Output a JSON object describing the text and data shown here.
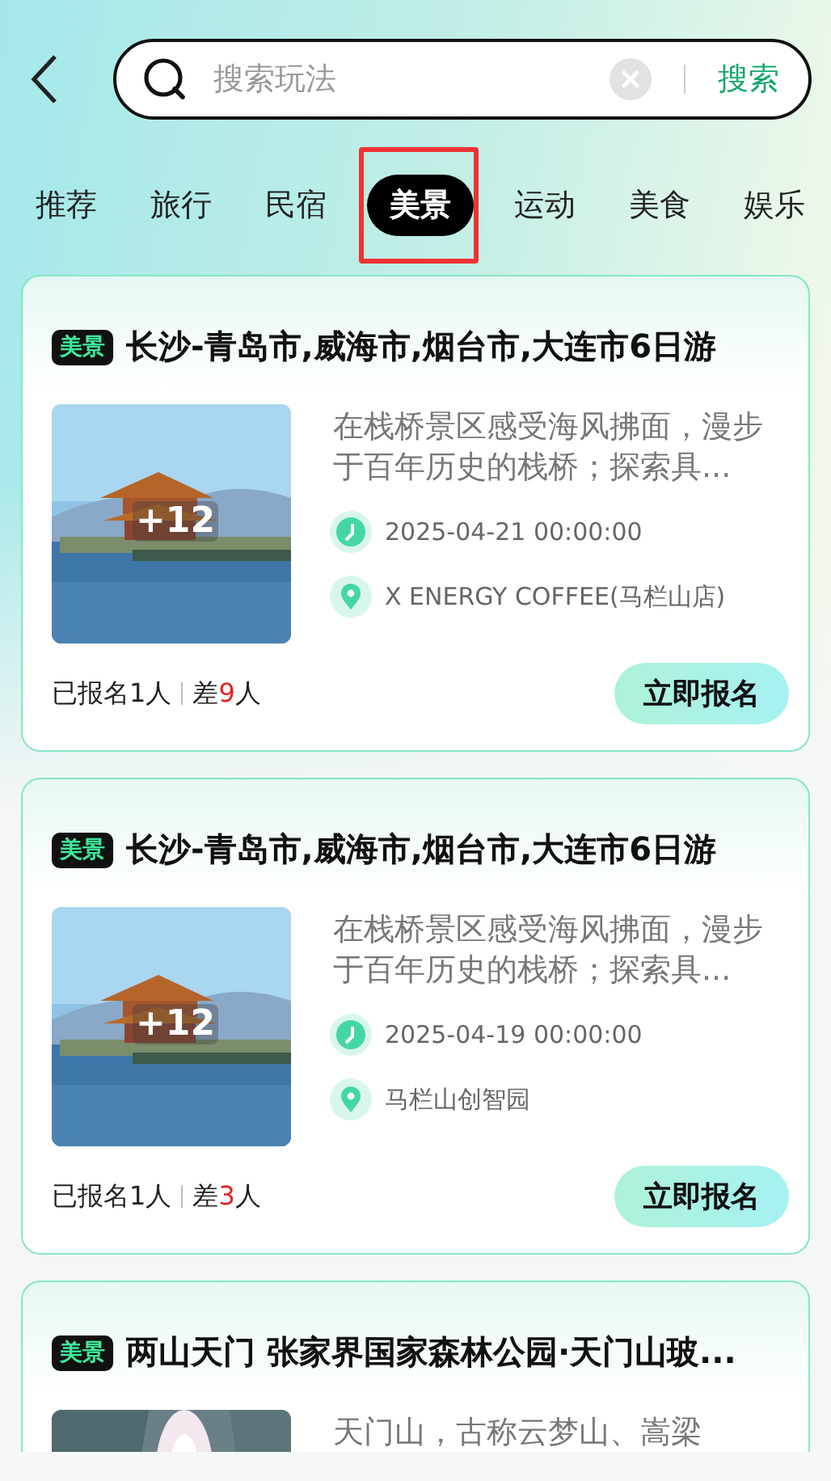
{
  "search": {
    "placeholder": "搜索玩法",
    "button": "搜索"
  },
  "tabs": [
    {
      "label": "推荐",
      "selected": false,
      "annotated": false
    },
    {
      "label": "旅行",
      "selected": false,
      "annotated": false
    },
    {
      "label": "民宿",
      "selected": false,
      "annotated": false
    },
    {
      "label": "美景",
      "selected": true,
      "annotated": true
    },
    {
      "label": "运动",
      "selected": false,
      "annotated": false
    },
    {
      "label": "美食",
      "selected": false,
      "annotated": false
    },
    {
      "label": "娱乐",
      "selected": false,
      "annotated": false
    }
  ],
  "cards": [
    {
      "badge": "美景",
      "title": "长沙-青岛市,威海市,烟台市,大连市6日游",
      "photo_count": "+12",
      "description": "在栈桥景区感受海风拂面，漫步于百年历史的栈桥；探索具...",
      "date": "2025-04-21 00:00:00",
      "location": "X ENERGY COFFEE(马栏山店)",
      "joined": "已报名1人",
      "missing_prefix": "差",
      "missing_count": "9",
      "missing_suffix": "人",
      "button": "立即报名"
    },
    {
      "badge": "美景",
      "title": "长沙-青岛市,威海市,烟台市,大连市6日游",
      "photo_count": "+12",
      "description": "在栈桥景区感受海风拂面，漫步于百年历史的栈桥；探索具...",
      "date": "2025-04-19 00:00:00",
      "location": "马栏山创智园",
      "joined": "已报名1人",
      "missing_prefix": "差",
      "missing_count": "3",
      "missing_suffix": "人",
      "button": "立即报名"
    },
    {
      "badge": "美景",
      "title": "两山天门 张家界国家森林公园·天门山玻...",
      "description": "天门山，古称云梦山、嵩梁"
    }
  ]
}
